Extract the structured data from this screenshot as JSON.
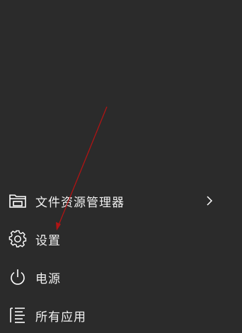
{
  "menu": {
    "items": [
      {
        "label": "文件资源管理器",
        "icon": "folder-icon",
        "has_submenu": true
      },
      {
        "label": "设置",
        "icon": "gear-icon",
        "has_submenu": false
      },
      {
        "label": "电源",
        "icon": "power-icon",
        "has_submenu": false
      },
      {
        "label": "所有应用",
        "icon": "list-icon",
        "has_submenu": false
      }
    ]
  },
  "colors": {
    "background": "#2b2b2b",
    "text": "#f2f2f2",
    "annotation_arrow": "#b01414"
  }
}
